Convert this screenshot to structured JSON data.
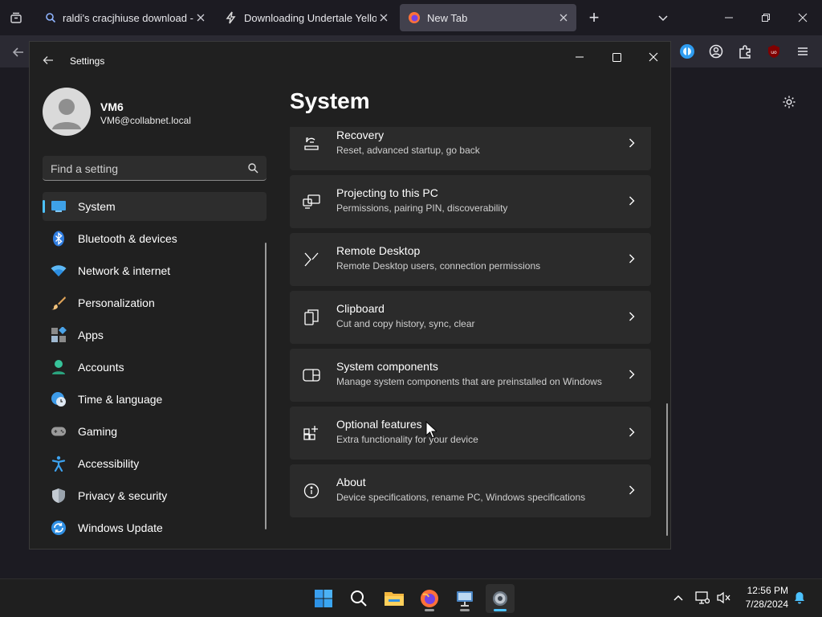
{
  "browser": {
    "tabs": [
      {
        "title": "raldi's cracjhiuse download - Se",
        "active": false,
        "icon": "search-icon"
      },
      {
        "title": "Downloading Undertale Yellow",
        "active": false,
        "icon": "bolt-icon"
      },
      {
        "title": "New Tab",
        "active": true,
        "icon": "firefox-icon"
      }
    ],
    "new_tab_label": "+"
  },
  "settings": {
    "window_title": "Settings",
    "user": {
      "name": "VM6",
      "email": "VM6@collabnet.local"
    },
    "search_placeholder": "Find a setting",
    "nav": [
      {
        "label": "System",
        "selected": true,
        "icon": "system-icon"
      },
      {
        "label": "Bluetooth & devices",
        "icon": "bluetooth-icon"
      },
      {
        "label": "Network & internet",
        "icon": "wifi-icon"
      },
      {
        "label": "Personalization",
        "icon": "brush-icon"
      },
      {
        "label": "Apps",
        "icon": "apps-icon"
      },
      {
        "label": "Accounts",
        "icon": "accounts-icon"
      },
      {
        "label": "Time & language",
        "icon": "clock-globe-icon"
      },
      {
        "label": "Gaming",
        "icon": "gamepad-icon"
      },
      {
        "label": "Accessibility",
        "icon": "accessibility-icon"
      },
      {
        "label": "Privacy & security",
        "icon": "shield-icon"
      },
      {
        "label": "Windows Update",
        "icon": "update-icon"
      }
    ],
    "page_title": "System",
    "cards": [
      {
        "title": "Recovery",
        "subtitle": "Reset, advanced startup, go back",
        "icon": "recovery-icon"
      },
      {
        "title": "Projecting to this PC",
        "subtitle": "Permissions, pairing PIN, discoverability",
        "icon": "projecting-icon"
      },
      {
        "title": "Remote Desktop",
        "subtitle": "Remote Desktop users, connection permissions",
        "icon": "remote-desktop-icon"
      },
      {
        "title": "Clipboard",
        "subtitle": "Cut and copy history, sync, clear",
        "icon": "clipboard-icon"
      },
      {
        "title": "System components",
        "subtitle": "Manage system components that are preinstalled on Windows",
        "icon": "system-components-icon"
      },
      {
        "title": "Optional features",
        "subtitle": "Extra functionality for your device",
        "icon": "optional-features-icon"
      },
      {
        "title": "About",
        "subtitle": "Device specifications, rename PC, Windows specifications",
        "icon": "info-icon"
      }
    ]
  },
  "taskbar": {
    "apps": [
      "start-icon",
      "search-icon",
      "file-explorer-icon",
      "firefox-icon",
      "remote-app-icon",
      "settings-icon"
    ],
    "clock": {
      "time": "12:56 PM",
      "date": "7/28/2024"
    }
  },
  "colors": {
    "accent": "#4cc2ff",
    "window_bg": "#202020",
    "card_bg": "#2b2b2b",
    "browser_bg": "#1c1b22"
  }
}
